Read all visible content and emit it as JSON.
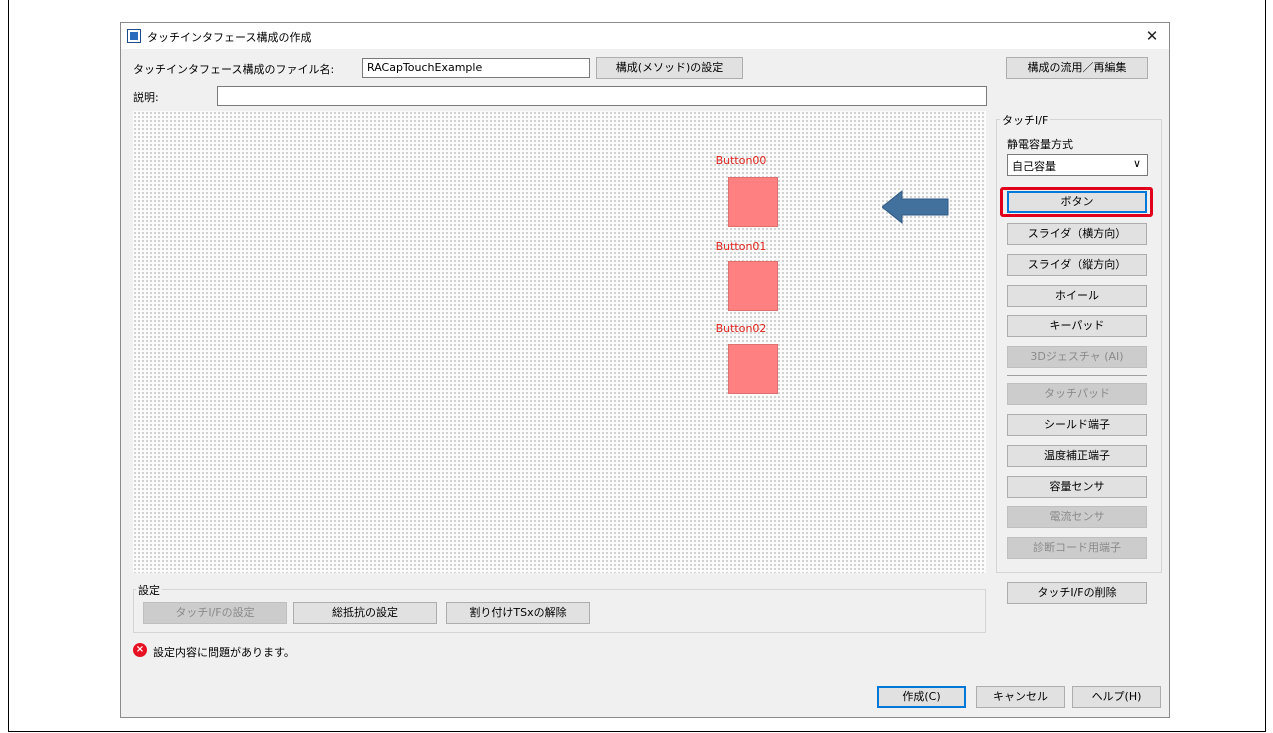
{
  "window": {
    "title": "タッチインタフェース構成の作成",
    "close": "✕"
  },
  "header": {
    "filename_label": "タッチインタフェース構成のファイル名:",
    "filename_value": "RACapTouchExample",
    "method_button": "構成(メソッド)の設定",
    "reuse_button": "構成の流用／再編集",
    "description_label": "説明:",
    "description_value": ""
  },
  "canvas": {
    "buttons": [
      {
        "label": "Button00"
      },
      {
        "label": "Button01"
      },
      {
        "label": "Button02"
      }
    ],
    "arrow_color": "#41719c",
    "element_color": "#ff8080",
    "label_color": "#e0241b"
  },
  "touch_if_panel": {
    "group_title": "タッチI/F",
    "method_label": "静電容量方式",
    "method_selected": "自己容量",
    "items": [
      {
        "label": "ボタン",
        "enabled": true,
        "highlighted": true
      },
      {
        "label": "スライダ（横方向）",
        "enabled": true
      },
      {
        "label": "スライダ（縦方向）",
        "enabled": true
      },
      {
        "label": "ホイール",
        "enabled": true
      },
      {
        "label": "キーパッド",
        "enabled": true
      },
      {
        "label": "3Dジェスチャ (AI)",
        "enabled": false
      },
      {
        "label": "タッチパッド",
        "enabled": false
      },
      {
        "label": "シールド端子",
        "enabled": true
      },
      {
        "label": "温度補正端子",
        "enabled": true
      },
      {
        "label": "容量センサ",
        "enabled": true
      },
      {
        "label": "電流センサ",
        "enabled": false
      },
      {
        "label": "診断コード用端子",
        "enabled": false
      }
    ],
    "delete_button": "タッチI/Fの削除"
  },
  "settings": {
    "group_title": "設定",
    "touch_if_settings": "タッチI/Fの設定",
    "resistor_settings": "総抵抗の設定",
    "release_tsx": "割り付けTSxの解除"
  },
  "status": {
    "message": "設定内容に問題があります。"
  },
  "footer": {
    "create_button": "作成(C)",
    "cancel_button": "キャンセル",
    "help_button": "ヘルプ(H)"
  }
}
